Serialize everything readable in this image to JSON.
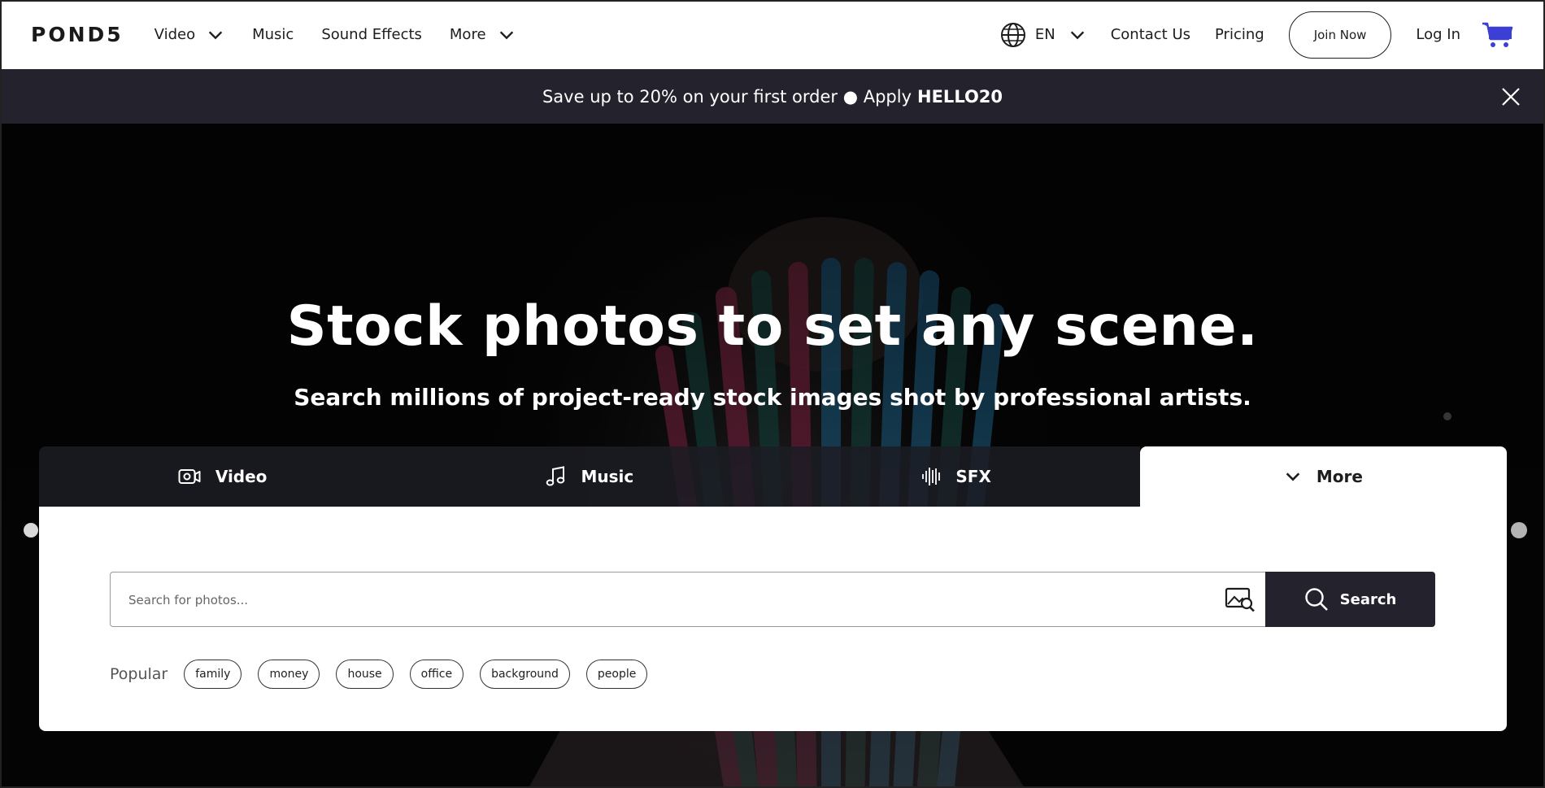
{
  "header": {
    "logo": "POND5",
    "nav": [
      {
        "label": "Video",
        "has_dropdown": true
      },
      {
        "label": "Music",
        "has_dropdown": false
      },
      {
        "label": "Sound Effects",
        "has_dropdown": false
      },
      {
        "label": "More",
        "has_dropdown": true
      }
    ],
    "language": "EN",
    "contact": "Contact Us",
    "pricing": "Pricing",
    "join": "Join Now",
    "login": "Log In"
  },
  "promo": {
    "text": "Save up to 20% on your first order ● Apply",
    "code": "HELLO20"
  },
  "hero": {
    "title": "Stock photos to set any scene.",
    "subtitle": "Search millions of project-ready stock images shot by professional artists."
  },
  "tabs": [
    {
      "label": "Video",
      "icon": "video-camera-icon",
      "active": false
    },
    {
      "label": "Music",
      "icon": "music-note-icon",
      "active": false
    },
    {
      "label": "SFX",
      "icon": "sound-wave-icon",
      "active": false
    },
    {
      "label": "More",
      "icon": "chevron-down-icon",
      "active": true
    }
  ],
  "search": {
    "placeholder": "Search for photos...",
    "value": "",
    "button": "Search"
  },
  "popular": {
    "label": "Popular",
    "tags": [
      "family",
      "money",
      "house",
      "office",
      "background",
      "people"
    ]
  },
  "colors": {
    "dark": "#24232d",
    "cart": "#3b3fd6",
    "white": "#ffffff"
  }
}
